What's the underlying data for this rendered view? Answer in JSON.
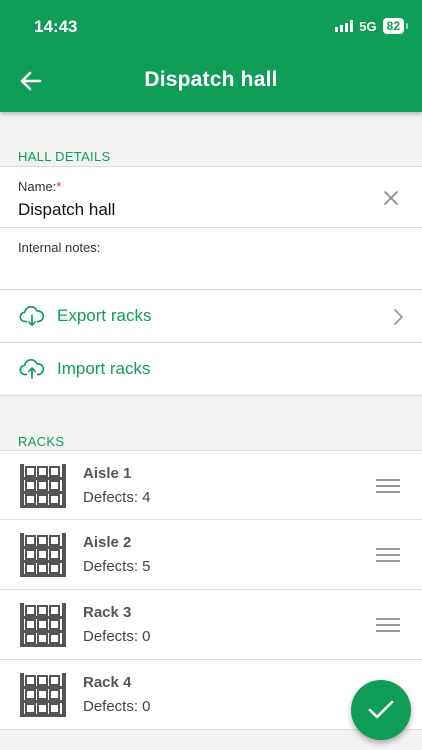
{
  "status_bar": {
    "time": "14:43",
    "network": "5G",
    "battery": "82"
  },
  "header": {
    "title": "Dispatch hall"
  },
  "hall_details": {
    "section_label": "HALL DETAILS",
    "name_label": "Name:",
    "name_required": "*",
    "name_value": "Dispatch hall",
    "notes_label": "Internal notes:",
    "notes_value": ""
  },
  "actions": {
    "export_label": "Export racks",
    "import_label": "Import racks"
  },
  "racks": {
    "section_label": "RACKS",
    "items": [
      {
        "name": "Aisle 1",
        "defects": "Defects: 4"
      },
      {
        "name": "Aisle 2",
        "defects": "Defects: 5"
      },
      {
        "name": "Rack 3",
        "defects": "Defects: 0"
      },
      {
        "name": "Rack 4",
        "defects": "Defects: 0"
      }
    ]
  },
  "colors": {
    "primary": "#0f9d58",
    "background": "#f2f2f2",
    "required": "#e53935"
  },
  "icons": [
    "back-arrow-icon",
    "close-icon",
    "cloud-download-icon",
    "cloud-upload-icon",
    "chevron-right-icon",
    "shelving-rack-icon",
    "drag-handle-icon",
    "checkmark-icon"
  ]
}
